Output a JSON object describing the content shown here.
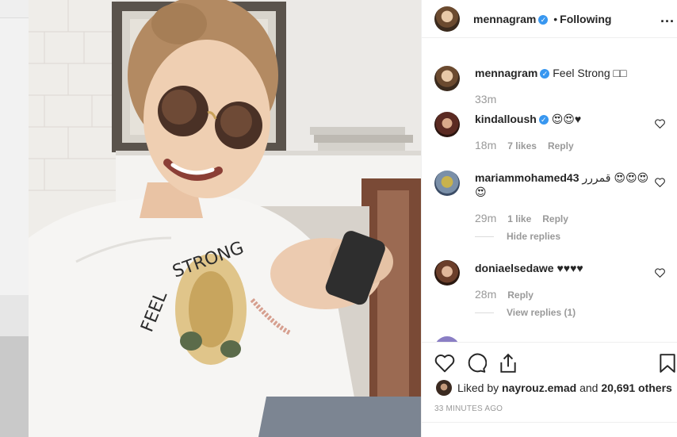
{
  "post": {
    "author": "mennagram",
    "separator": "•",
    "follow_status": "Following",
    "more_label": "..."
  },
  "comments": [
    {
      "user": "mennagram",
      "verified": true,
      "text": "Feel Strong □□",
      "time": "33m",
      "likes": "",
      "reply": ""
    },
    {
      "user": "kindalloush",
      "verified": true,
      "text": "😍😍♥",
      "time": "18m",
      "likes": "7 likes",
      "reply": "Reply"
    },
    {
      "user": "mariammohamed43",
      "verified": false,
      "text": "قمررر 😍😍😍",
      "text2": "😍",
      "time": "29m",
      "likes": "1 like",
      "reply": "Reply",
      "replies_toggle": "Hide replies"
    },
    {
      "user": "doniaelsedawe",
      "verified": false,
      "text": "♥♥♥♥",
      "time": "28m",
      "likes": "",
      "reply": "Reply",
      "replies_toggle": "View replies (1)"
    }
  ],
  "likes": {
    "prefix": "Liked by",
    "user": "nayrouz.emad",
    "middle": "and",
    "count": "20,691 others"
  },
  "timestamp": "33 MINUTES AGO",
  "colors": {
    "verified": "#3897f0",
    "muted": "#999999",
    "text": "#262626"
  },
  "icons": [
    "heart-icon",
    "comment-icon",
    "share-icon",
    "bookmark-icon",
    "more-icon",
    "verified-icon"
  ]
}
